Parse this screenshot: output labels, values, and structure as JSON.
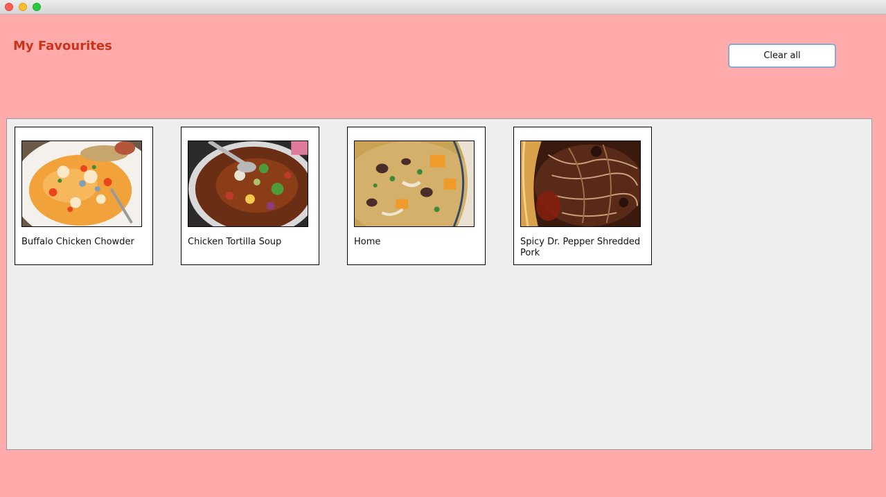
{
  "window": {
    "controls": [
      "close-icon",
      "minimize-icon",
      "maximize-icon"
    ]
  },
  "header": {
    "title": "My Favourites",
    "clear_all_label": "Clear all"
  },
  "colors": {
    "background": "#ffabab",
    "title": "#c9341b",
    "panel": "#eeeeee"
  },
  "favourites": [
    {
      "name": "Buffalo Chicken Chowder",
      "image": "chowder-photo"
    },
    {
      "name": "Chicken Tortilla Soup",
      "image": "tortilla-soup-photo"
    },
    {
      "name": "Home",
      "image": "squash-stew-photo"
    },
    {
      "name": "Spicy Dr. Pepper Shredded Pork",
      "image": "shredded-pork-photo"
    }
  ]
}
